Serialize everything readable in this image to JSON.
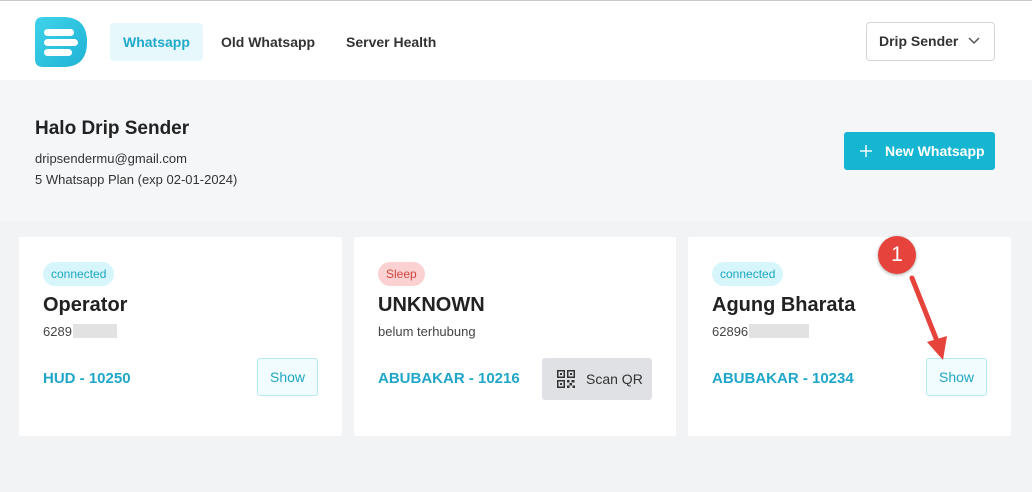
{
  "header": {
    "logo": "drip-sender-logo",
    "tabs": [
      {
        "label": "Whatsapp",
        "active": true
      },
      {
        "label": "Old Whatsapp",
        "active": false
      },
      {
        "label": "Server Health",
        "active": false
      }
    ],
    "user_menu": "Drip Sender"
  },
  "profile": {
    "greeting": "Halo Drip Sender",
    "email": "dripsendermu@gmail.com",
    "plan": "5 Whatsapp Plan (exp 02-01-2024)",
    "new_button": "New Whatsapp"
  },
  "devices": [
    {
      "status": "connected",
      "name": "Operator",
      "phone": "6289",
      "host": "HUD - 10250",
      "action": "Show"
    },
    {
      "status": "Sleep",
      "name": "UNKNOWN",
      "phone": "belum terhubung",
      "host": "ABUBAKAR - 10216",
      "action": "Scan QR"
    },
    {
      "status": "connected",
      "name": "Agung Bharata",
      "phone": "62896",
      "host": "ABUBAKAR - 10234",
      "action": "Show"
    }
  ],
  "annotation": {
    "number": "1"
  },
  "colors": {
    "accent": "#16b6d3",
    "link": "#1fa6c9",
    "connected_bg": "#d6f6fb",
    "sleep_bg": "#fbd1d1",
    "annotation": "#e5433b"
  }
}
